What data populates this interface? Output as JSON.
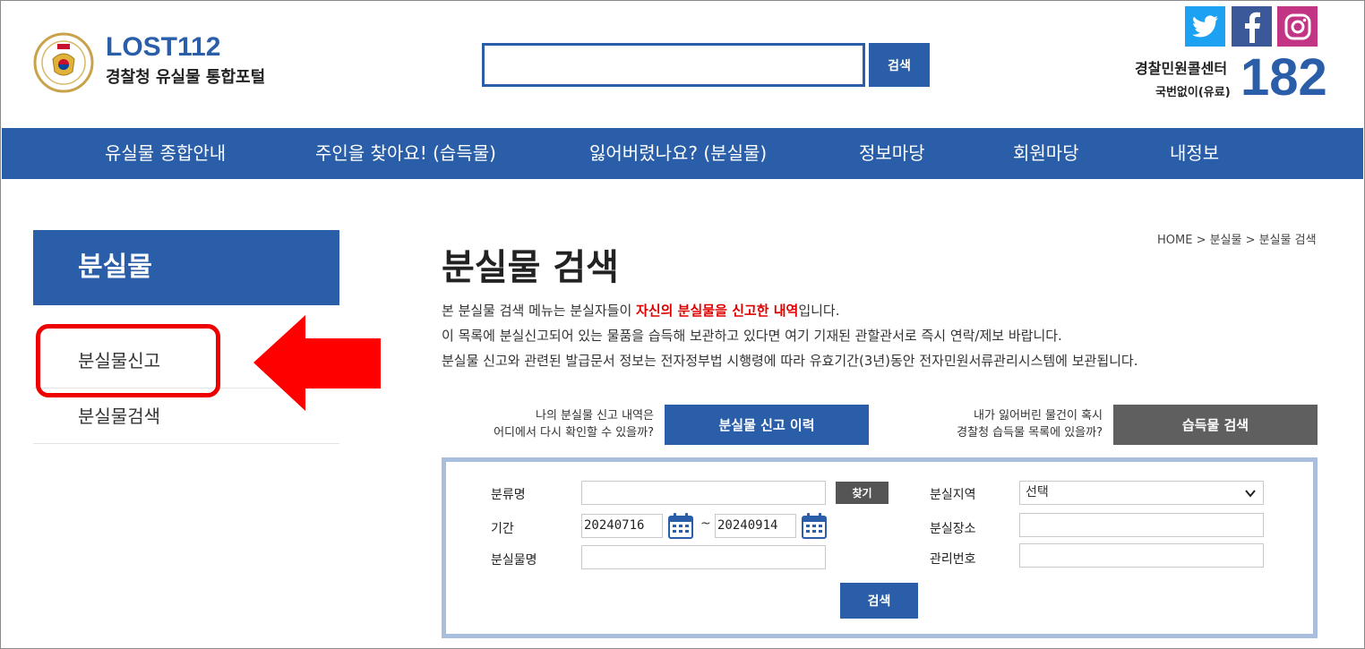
{
  "header": {
    "logo_title": "LOST112",
    "logo_subtitle": "경찰청 유실물 통합포털",
    "search_placeholder": "",
    "search_button": "검색",
    "sns": [
      "twitter-icon",
      "facebook-icon",
      "instagram-icon"
    ],
    "call_center_label": "경찰민원콜센터",
    "call_center_sub": "국번없이(유료)",
    "call_center_number": "182"
  },
  "nav": {
    "items": [
      "유실물 종합안내",
      "주인을 찾아요! (습득물)",
      "잃어버렸나요? (분실물)",
      "정보마당",
      "회원마당",
      "내정보"
    ]
  },
  "sidebar": {
    "heading": "분실물",
    "items": [
      "분실물신고",
      "분실물검색"
    ]
  },
  "main": {
    "breadcrumb": "HOME > 분실물 > 분실물 검색",
    "title": "분실물 검색",
    "desc1_before": "본 분실물 검색 메뉴는 분실자들이 ",
    "desc1_highlight": "자신의 분실물을 신고한 내역",
    "desc1_after": "입니다.",
    "desc2": "이 목록에 분실신고되어 있는 물품을 습득해 보관하고 있다면 여기 기재된 관할관서로 즉시 연락/제보 바랍니다.",
    "desc3": "분실물 신고와 관련된 발급문서 정보는 전자정부법 시행령에 따라 유효기간(3년)동안 전자민원서류관리시스템에 보관됩니다.",
    "promo1_line1": "나의 분실물 신고 내역은",
    "promo1_line2": "어디에서 다시 확인할 수 있을까?",
    "promo1_button": "분실물 신고 이력",
    "promo2_line1": "내가 잃어버린 물건이 혹시",
    "promo2_line2": "경찰청 습득물 목록에 있을까?",
    "promo2_button": "습득물 검색"
  },
  "search_form": {
    "category_label": "분류명",
    "category_value": "",
    "find_button": "찾기",
    "period_label": "기간",
    "date_from": "20240716",
    "date_sep": "~",
    "date_to": "20240914",
    "item_name_label": "분실물명",
    "item_name_value": "",
    "region_label": "분실지역",
    "region_value": "선택",
    "place_label": "분실장소",
    "place_value": "",
    "mgmt_no_label": "관리번호",
    "mgmt_no_value": "",
    "submit_button": "검색"
  }
}
